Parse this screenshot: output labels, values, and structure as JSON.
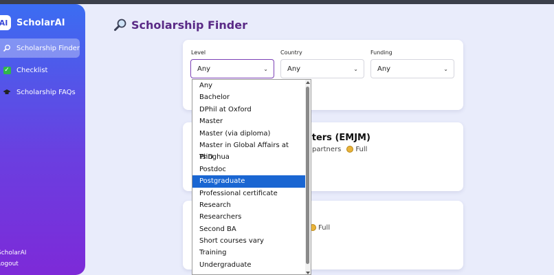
{
  "brand": {
    "logo_text": "AI",
    "name": "ScholarAI"
  },
  "sidebar": {
    "items": [
      {
        "label": "Scholarship Finder",
        "icon": "magnifier-icon",
        "active": true
      },
      {
        "label": "Checklist",
        "icon": "checkbox-icon",
        "active": false
      },
      {
        "label": "Scholarship FAQs",
        "icon": "graduation-cap-icon",
        "active": false
      }
    ],
    "footer_brand": "ScholarAI",
    "logout_label": "Logout"
  },
  "page": {
    "title": "Scholarship Finder",
    "title_icon": "magnifier-icon"
  },
  "filters": {
    "level": {
      "label": "Level",
      "value": "Any"
    },
    "country": {
      "label": "Country",
      "value": "Any"
    },
    "funding": {
      "label": "Funding",
      "value": "Any"
    }
  },
  "results": [
    {
      "title_visible": "sters (EMJM)",
      "meta_visible": "partners",
      "funding": "Full"
    },
    {
      "funding": "Full"
    }
  ],
  "dropdown": {
    "options": [
      "Any",
      "Bachelor",
      "DPhil at Oxford",
      "Master",
      "Master (via diploma)",
      "Master in Global Affairs at Tsinghua",
      "PhD",
      "Postdoc",
      "Postgraduate",
      "Professional certificate",
      "Research",
      "Researchers",
      "Second BA",
      "Short courses vary",
      "Training",
      "Undergraduate"
    ],
    "highlighted": "Postgraduate"
  },
  "colors": {
    "sidebar_top": "#3b6df2",
    "sidebar_bottom": "#7d2ad8",
    "title": "#5a2a86",
    "focus_border": "#7b3fb5",
    "selected_option": "#1a66d2"
  }
}
